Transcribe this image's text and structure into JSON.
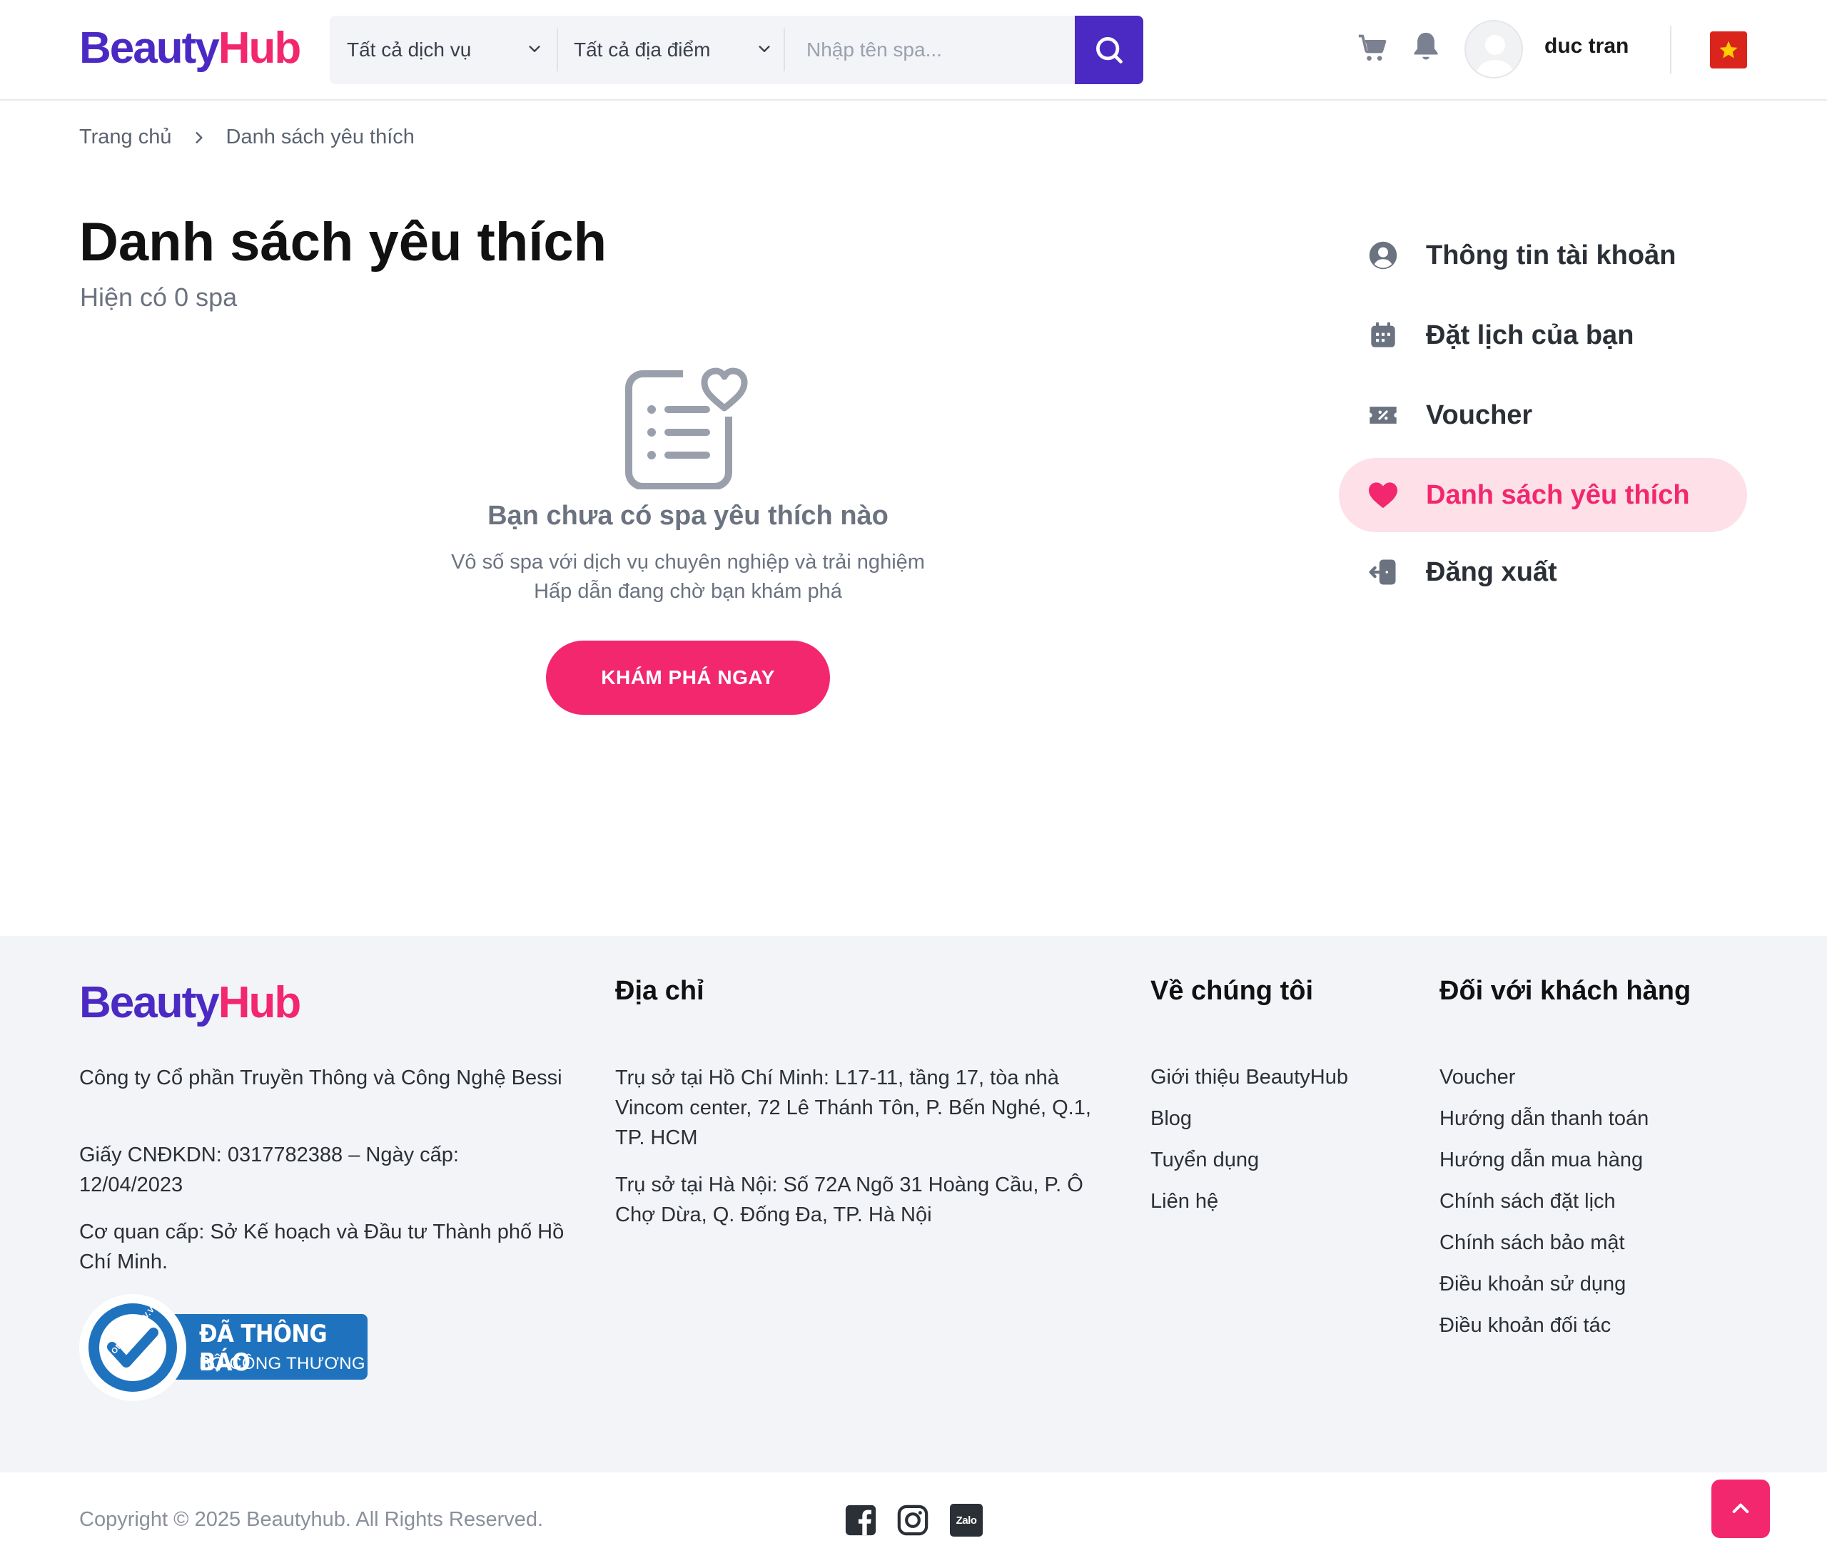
{
  "header": {
    "logo_part1": "Beauty",
    "logo_part2": "Hub",
    "service_select": "Tất cả dịch vụ",
    "location_select": "Tất cả địa điểm",
    "search_placeholder": "Nhập tên spa...",
    "username": "duc tran"
  },
  "breadcrumb": {
    "home": "Trang chủ",
    "current": "Danh sách yêu thích"
  },
  "main": {
    "title": "Danh sách yêu thích",
    "subtitle": "Hiện có 0 spa",
    "empty_title": "Bạn chưa có spa yêu thích nào",
    "empty_desc_line1": "Vô số spa với dịch vụ chuyên nghiệp và trải nghiệm",
    "empty_desc_line2": "Hấp dẫn đang chờ bạn khám phá",
    "explore_button": "KHÁM PHÁ NGAY"
  },
  "sidebar": {
    "items": [
      {
        "label": "Thông tin tài khoản",
        "icon": "user-circle-icon"
      },
      {
        "label": "Đặt lịch của bạn",
        "icon": "calendar-icon"
      },
      {
        "label": "Voucher",
        "icon": "ticket-icon"
      },
      {
        "label": "Danh sách yêu thích",
        "icon": "heart-icon",
        "active": true
      },
      {
        "label": "Đăng xuất",
        "icon": "logout-icon"
      }
    ]
  },
  "footer": {
    "company_name": "Công ty Cổ phần Truyền Thông và Công Nghệ Bessi",
    "license": "Giấy CNĐKDN: 0317782388 – Ngày cấp: 12/04/2023",
    "issuer": "Cơ quan cấp: Sở Kế hoạch và Đầu tư Thành phố Hồ Chí Minh.",
    "badge_line1": "ĐÃ THÔNG BÁO",
    "badge_line2": "BỘ CÔNG THƯƠNG",
    "badge_ring": "ONLINE.GOV.VN",
    "address_heading": "Địa chỉ",
    "address_hcm": "Trụ sở tại Hồ Chí Minh: L17-11, tầng 17, tòa nhà Vincom center, 72 Lê Thánh Tôn, P. Bến Nghé, Q.1, TP. HCM",
    "address_hn": "Trụ sở tại Hà Nội: Số 72A Ngõ 31 Hoàng Cầu, P. Ô Chợ Dừa, Q. Đống Đa, TP. Hà Nội",
    "about_heading": "Về chúng tôi",
    "about_links": [
      "Giới thiệu BeautyHub",
      "Blog",
      "Tuyển dụng",
      "Liên hệ"
    ],
    "customer_heading": "Đối với khách hàng",
    "customer_links": [
      "Voucher",
      "Hướng dẫn thanh toán",
      "Hướng dẫn mua hàng",
      "Chính sách đặt lịch",
      "Chính sách bảo mật",
      "Điều khoản sử dụng",
      "Điều khoản đối tác"
    ],
    "copyright": "Copyright © 2025 Beautyhub. All Rights Reserved.",
    "zalo_label": "Zalo"
  },
  "colors": {
    "brand_purple": "#4b2ac4",
    "brand_pink": "#f2276e",
    "active_bg": "#fde0e8",
    "footer_bg": "#f2f4f8"
  }
}
